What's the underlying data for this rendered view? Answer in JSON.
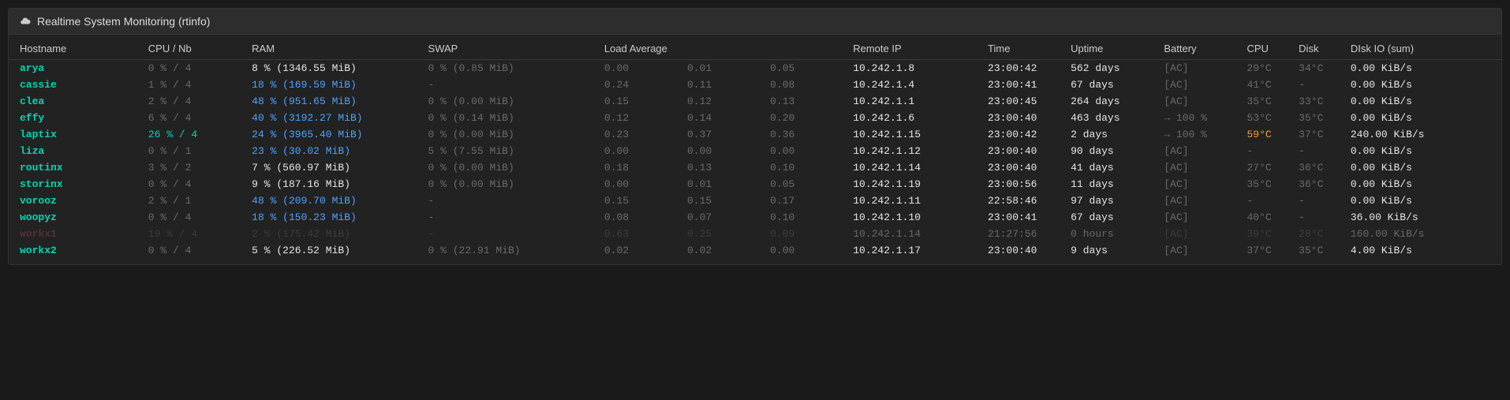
{
  "header": {
    "title": "Realtime System Monitoring (rtinfo)"
  },
  "columns": {
    "hostname": "Hostname",
    "cpu": "CPU / Nb",
    "ram": "RAM",
    "swap": "SWAP",
    "load": "Load Average",
    "ip": "Remote IP",
    "time": "Time",
    "uptime": "Uptime",
    "battery": "Battery",
    "tcpu": "CPU",
    "tdisk": "Disk",
    "io": "DIsk IO (sum)"
  },
  "rows": [
    {
      "hostname": "arya",
      "cpu": "0 % / 4",
      "cpu_cls": "dim",
      "ram": "8 % (1346.55 MiB)",
      "ram_cls": "val-default",
      "swap": "0 % (0.85 MiB)",
      "swap_cls": "dim",
      "la1": "0.00",
      "la1_cls": "dim",
      "la2": "0.01",
      "la2_cls": "dim",
      "la3": "0.05",
      "la3_cls": "dim",
      "ip": "10.242.1.8",
      "time": "23:00:42",
      "uptime": "562 days",
      "battery": "[AC]",
      "battery_cls": "dim",
      "tcpu": "29°C",
      "tcpu_cls": "dim",
      "tdisk": "34°C",
      "tdisk_cls": "dim",
      "io": "0.00 KiB/s",
      "faded": false
    },
    {
      "hostname": "cassie",
      "cpu": "1 % / 4",
      "cpu_cls": "dim",
      "ram": "18 % (169.59 MiB)",
      "ram_cls": "val-blue",
      "swap": "-",
      "swap_cls": "dim",
      "la1": "0.24",
      "la1_cls": "dim",
      "la2": "0.11",
      "la2_cls": "dim",
      "la3": "0.08",
      "la3_cls": "dim",
      "ip": "10.242.1.4",
      "time": "23:00:41",
      "uptime": "67 days",
      "battery": "[AC]",
      "battery_cls": "dim",
      "tcpu": "41°C",
      "tcpu_cls": "dim",
      "tdisk": "-",
      "tdisk_cls": "dim",
      "io": "0.00 KiB/s",
      "faded": false
    },
    {
      "hostname": "clea",
      "cpu": "2 % / 4",
      "cpu_cls": "dim",
      "ram": "48 % (951.65 MiB)",
      "ram_cls": "val-blue",
      "swap": "0 % (0.00 MiB)",
      "swap_cls": "dim",
      "la1": "0.15",
      "la1_cls": "dim",
      "la2": "0.12",
      "la2_cls": "dim",
      "la3": "0.13",
      "la3_cls": "dim",
      "ip": "10.242.1.1",
      "time": "23:00:45",
      "uptime": "264 days",
      "battery": "[AC]",
      "battery_cls": "dim",
      "tcpu": "35°C",
      "tcpu_cls": "dim",
      "tdisk": "33°C",
      "tdisk_cls": "dim",
      "io": "0.00 KiB/s",
      "faded": false
    },
    {
      "hostname": "effy",
      "cpu": "6 % / 4",
      "cpu_cls": "dim",
      "ram": "40 % (3192.27 MiB)",
      "ram_cls": "val-blue",
      "swap": "0 % (0.14 MiB)",
      "swap_cls": "dim",
      "la1": "0.12",
      "la1_cls": "dim",
      "la2": "0.14",
      "la2_cls": "dim",
      "la3": "0.20",
      "la3_cls": "dim",
      "ip": "10.242.1.6",
      "time": "23:00:40",
      "uptime": "463 days",
      "battery": "→ 100 %",
      "battery_cls": "dim",
      "tcpu": "53°C",
      "tcpu_cls": "dim",
      "tdisk": "35°C",
      "tdisk_cls": "dim",
      "io": "0.00 KiB/s",
      "faded": false
    },
    {
      "hostname": "laptix",
      "cpu": "26 % / 4",
      "cpu_cls": "val-cyan",
      "ram": "24 % (3965.40 MiB)",
      "ram_cls": "val-blue",
      "swap": "0 % (0.00 MiB)",
      "swap_cls": "dim",
      "la1": "0.23",
      "la1_cls": "dim",
      "la2": "0.37",
      "la2_cls": "dim",
      "la3": "0.36",
      "la3_cls": "dim",
      "ip": "10.242.1.15",
      "time": "23:00:42",
      "uptime": "2 days",
      "battery": "→ 100 %",
      "battery_cls": "dim",
      "tcpu": "59°C",
      "tcpu_cls": "val-orange",
      "tdisk": "37°C",
      "tdisk_cls": "dim",
      "io": "240.00 KiB/s",
      "faded": false
    },
    {
      "hostname": "liza",
      "cpu": "0 % / 1",
      "cpu_cls": "dim",
      "ram": "23 % (30.02 MiB)",
      "ram_cls": "val-blue",
      "swap": "5 % (7.55 MiB)",
      "swap_cls": "dim",
      "la1": "0.00",
      "la1_cls": "dim",
      "la2": "0.00",
      "la2_cls": "dim",
      "la3": "0.00",
      "la3_cls": "dim",
      "ip": "10.242.1.12",
      "time": "23:00:40",
      "uptime": "90 days",
      "battery": "[AC]",
      "battery_cls": "dim",
      "tcpu": "-",
      "tcpu_cls": "dim",
      "tdisk": "-",
      "tdisk_cls": "dim",
      "io": "0.00 KiB/s",
      "faded": false
    },
    {
      "hostname": "routinx",
      "cpu": "3 % / 2",
      "cpu_cls": "dim",
      "ram": "7 % (560.97 MiB)",
      "ram_cls": "val-default",
      "swap": "0 % (0.00 MiB)",
      "swap_cls": "dim",
      "la1": "0.18",
      "la1_cls": "dim",
      "la2": "0.13",
      "la2_cls": "dim",
      "la3": "0.10",
      "la3_cls": "dim",
      "ip": "10.242.1.14",
      "time": "23:00:40",
      "uptime": "41 days",
      "battery": "[AC]",
      "battery_cls": "dim",
      "tcpu": "27°C",
      "tcpu_cls": "dim",
      "tdisk": "36°C",
      "tdisk_cls": "dim",
      "io": "0.00 KiB/s",
      "faded": false
    },
    {
      "hostname": "storinx",
      "cpu": "0 % / 4",
      "cpu_cls": "dim",
      "ram": "9 % (187.16 MiB)",
      "ram_cls": "val-default",
      "swap": "0 % (0.00 MiB)",
      "swap_cls": "dim",
      "la1": "0.00",
      "la1_cls": "dim",
      "la2": "0.01",
      "la2_cls": "dim",
      "la3": "0.05",
      "la3_cls": "dim",
      "ip": "10.242.1.19",
      "time": "23:00:56",
      "uptime": "11 days",
      "battery": "[AC]",
      "battery_cls": "dim",
      "tcpu": "35°C",
      "tcpu_cls": "dim",
      "tdisk": "36°C",
      "tdisk_cls": "dim",
      "io": "0.00 KiB/s",
      "faded": false
    },
    {
      "hostname": "vorooz",
      "cpu": "2 % / 1",
      "cpu_cls": "dim",
      "ram": "48 % (209.70 MiB)",
      "ram_cls": "val-blue",
      "swap": "-",
      "swap_cls": "dim",
      "la1": "0.15",
      "la1_cls": "dim",
      "la2": "0.15",
      "la2_cls": "dim",
      "la3": "0.17",
      "la3_cls": "dim",
      "ip": "10.242.1.11",
      "time": "22:58:46",
      "uptime": "97 days",
      "battery": "[AC]",
      "battery_cls": "dim",
      "tcpu": "-",
      "tcpu_cls": "dim",
      "tdisk": "-",
      "tdisk_cls": "dim",
      "io": "0.00 KiB/s",
      "faded": false
    },
    {
      "hostname": "woopyz",
      "cpu": "0 % / 4",
      "cpu_cls": "dim",
      "ram": "18 % (150.23 MiB)",
      "ram_cls": "val-blue",
      "swap": "-",
      "swap_cls": "dim",
      "la1": "0.08",
      "la1_cls": "dim",
      "la2": "0.07",
      "la2_cls": "dim",
      "la3": "0.10",
      "la3_cls": "dim",
      "ip": "10.242.1.10",
      "time": "23:00:41",
      "uptime": "67 days",
      "battery": "[AC]",
      "battery_cls": "dim",
      "tcpu": "40°C",
      "tcpu_cls": "dim",
      "tdisk": "-",
      "tdisk_cls": "dim",
      "io": "36.00 KiB/s",
      "faded": false
    },
    {
      "hostname": "workx1",
      "cpu": "19 % / 4",
      "cpu_cls": "dim",
      "ram": "2 % (175.42 MiB)",
      "ram_cls": "dim",
      "swap": "-",
      "swap_cls": "dim",
      "la1": "0.63",
      "la1_cls": "dim",
      "la2": "0.25",
      "la2_cls": "dim",
      "la3": "0.09",
      "la3_cls": "dim",
      "ip": "10.242.1.14",
      "time": "21:27:56",
      "uptime": "0 hours",
      "battery": "[AC]",
      "battery_cls": "dim",
      "tcpu": "39°C",
      "tcpu_cls": "dim",
      "tdisk": "28°C",
      "tdisk_cls": "dim",
      "io": "160.00 KiB/s",
      "faded": true
    },
    {
      "hostname": "workx2",
      "cpu": "0 % / 4",
      "cpu_cls": "dim",
      "ram": "5 % (226.52 MiB)",
      "ram_cls": "val-default",
      "swap": "0 % (22.91 MiB)",
      "swap_cls": "dim",
      "la1": "0.02",
      "la1_cls": "dim",
      "la2": "0.02",
      "la2_cls": "dim",
      "la3": "0.00",
      "la3_cls": "dim",
      "ip": "10.242.1.17",
      "time": "23:00:40",
      "uptime": "9 days",
      "battery": "[AC]",
      "battery_cls": "dim",
      "tcpu": "37°C",
      "tcpu_cls": "dim",
      "tdisk": "35°C",
      "tdisk_cls": "dim",
      "io": "4.00 KiB/s",
      "faded": false
    }
  ]
}
